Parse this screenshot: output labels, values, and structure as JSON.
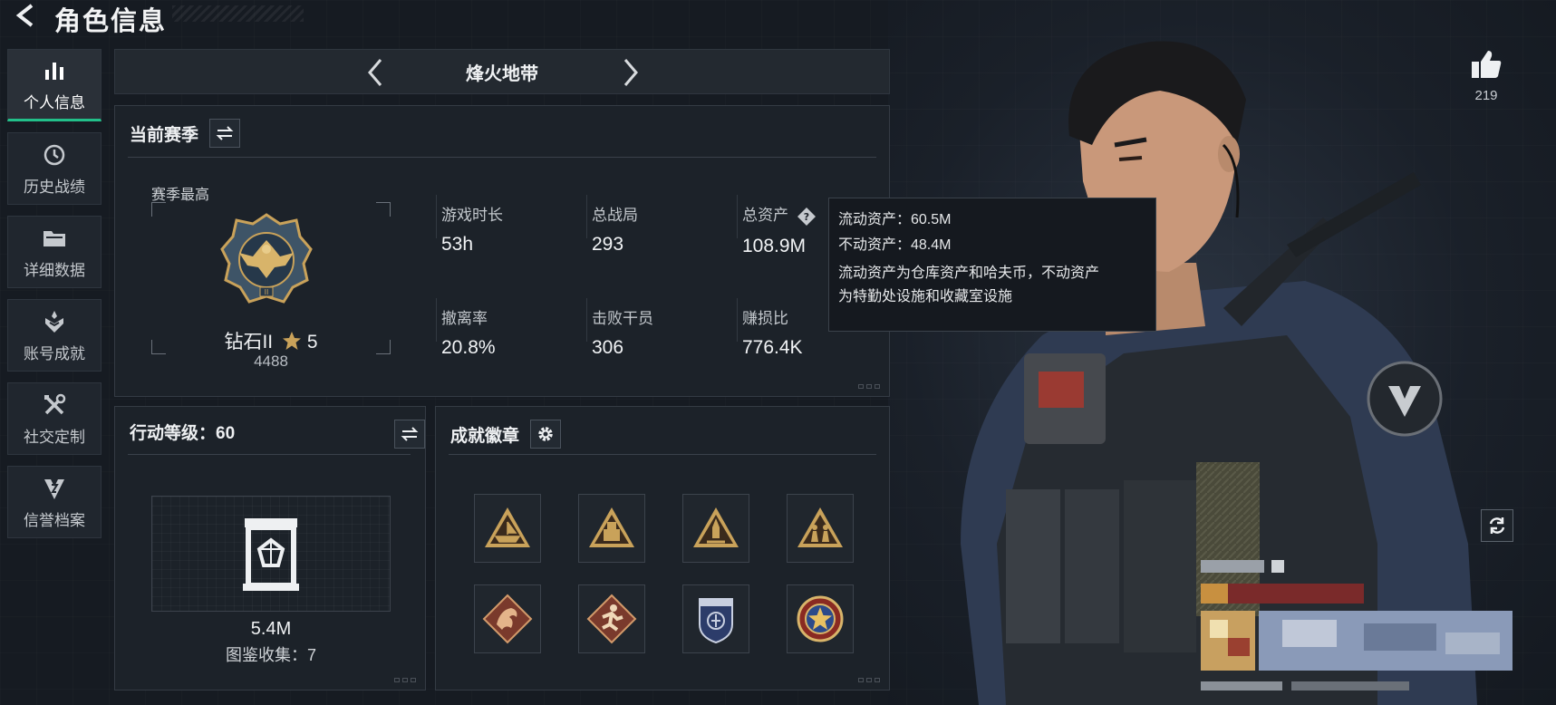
{
  "header": {
    "title": "角色信息"
  },
  "sidebar": {
    "items": [
      {
        "label": "个人信息",
        "icon": "bar-chart-icon",
        "active": true
      },
      {
        "label": "历史战绩",
        "icon": "clock-icon",
        "active": false
      },
      {
        "label": "详细数据",
        "icon": "folder-icon",
        "active": false
      },
      {
        "label": "账号成就",
        "icon": "achievement-icon",
        "active": false
      },
      {
        "label": "社交定制",
        "icon": "tools-icon",
        "active": false
      },
      {
        "label": "信誉档案",
        "icon": "reputation-icon",
        "active": false
      }
    ]
  },
  "mode": {
    "title": "烽火地带"
  },
  "season": {
    "title": "当前赛季",
    "best_label": "赛季最高",
    "rank_name": "钻石II",
    "rank_stars": "5",
    "rank_score": "4488",
    "stats": [
      {
        "label": "游戏时长",
        "value": "53h"
      },
      {
        "label": "总战局",
        "value": "293"
      },
      {
        "label": "总资产",
        "value": "108.9M"
      },
      {
        "label": "撤离率",
        "value": "20.8%"
      },
      {
        "label": "击败干员",
        "value": "306"
      },
      {
        "label": "赚损比",
        "value": "776.4K"
      }
    ]
  },
  "tooltip": {
    "liquid": "流动资产：60.5M",
    "fixed": "不动资产：48.4M",
    "desc_line1": "流动资产为仓库资产和哈夫币，不动资产",
    "desc_line2": "为特勤处设施和收藏室设施"
  },
  "level": {
    "title": "行动等级：60",
    "value": "5.4M",
    "collection": "图鉴收集：7"
  },
  "badges": {
    "title": "成就徽章",
    "items": [
      "badge-ship-icon",
      "badge-crate-icon",
      "badge-rocket-icon",
      "badge-soldiers-icon",
      "badge-dragon-icon",
      "badge-runner-icon",
      "badge-police-icon",
      "badge-star-medal-icon"
    ]
  },
  "likes": {
    "count": "219"
  },
  "colors": {
    "accent": "#22c08a",
    "gold": "#c9a25a",
    "panel": "#1c2229"
  }
}
